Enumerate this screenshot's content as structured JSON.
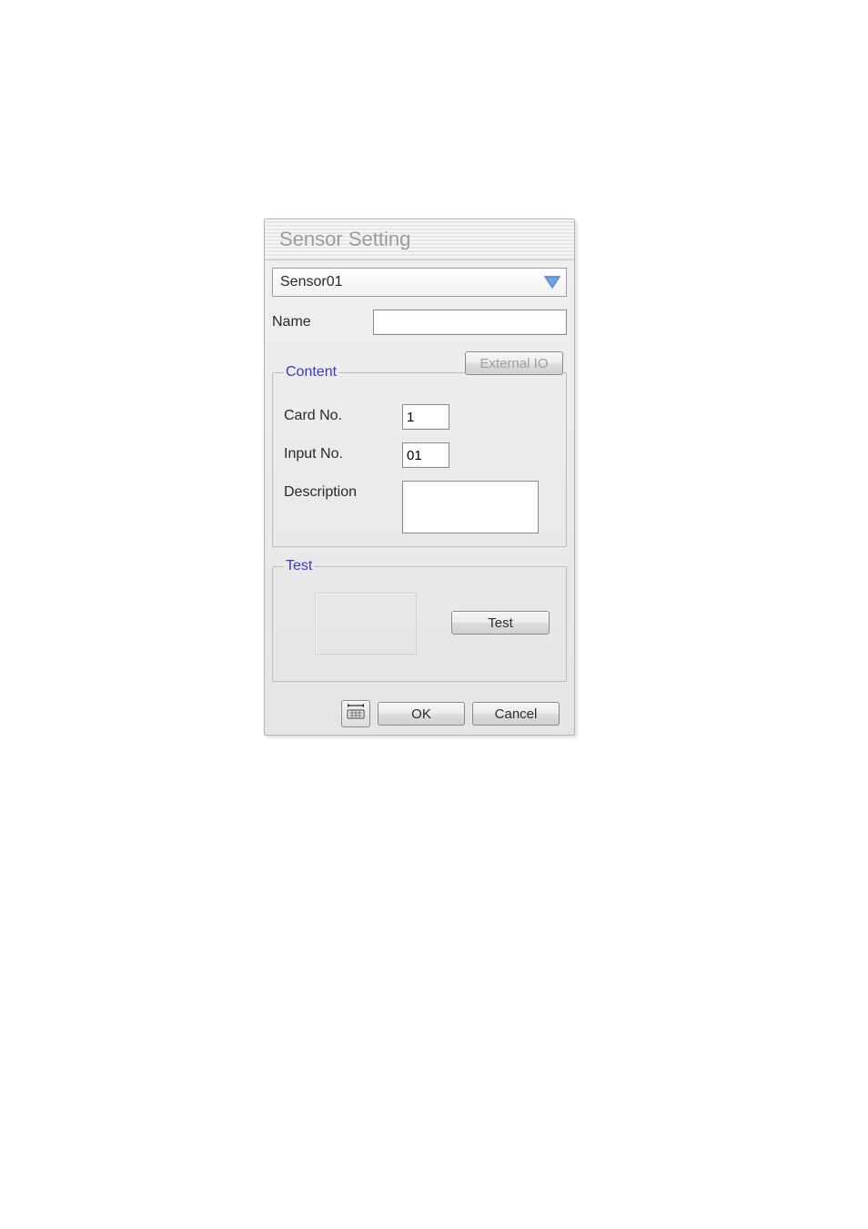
{
  "dialog": {
    "title": "Sensor Setting",
    "sensor_dropdown": {
      "selected": "Sensor01"
    },
    "name_label": "Name",
    "name_value": "",
    "external_io_label": "External IO",
    "content": {
      "legend": "Content",
      "card_no_label": "Card No.",
      "card_no_value": "1",
      "input_no_label": "Input No.",
      "input_no_value": "01",
      "description_label": "Description",
      "description_value": ""
    },
    "test": {
      "legend": "Test",
      "test_button": "Test"
    },
    "footer": {
      "ok": "OK",
      "cancel": "Cancel"
    }
  }
}
